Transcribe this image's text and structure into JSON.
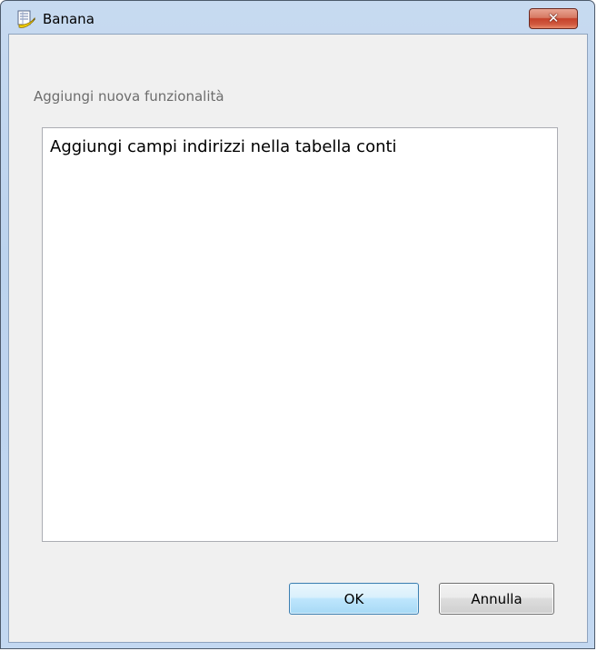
{
  "window": {
    "title": "Banana",
    "icon": "banana-app-icon",
    "close_label": "✕"
  },
  "dialog": {
    "prompt": "Aggiungi nuova funzionalità",
    "text_value": "Aggiungi campi indirizzi nella tabella conti"
  },
  "buttons": {
    "ok_label": "OK",
    "cancel_label": "Annulla"
  },
  "colors": {
    "titlebar": "#bcd3ee",
    "client_bg": "#f0f0f0",
    "close_button": "#c6422b",
    "ok_border": "#3c7fb1"
  }
}
